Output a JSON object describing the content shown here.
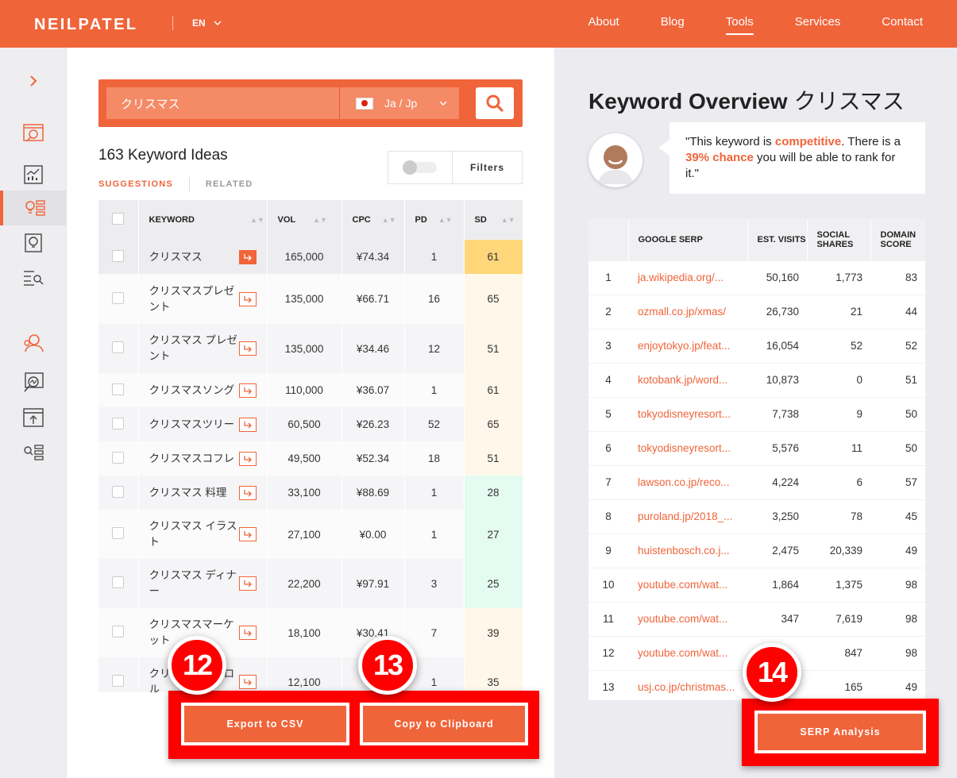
{
  "header": {
    "logo": "NEILPATEL",
    "language": "EN",
    "nav": [
      "About",
      "Blog",
      "Tools",
      "Services",
      "Contact"
    ],
    "active_nav": "Tools"
  },
  "search": {
    "value": "クリスマス",
    "language_label": "Ja / Jp"
  },
  "keywords": {
    "count_label": "163 Keyword Ideas",
    "tab_suggestions": "SUGGESTIONS",
    "tab_related": "RELATED",
    "filters_label": "Filters",
    "columns": [
      "KEYWORD",
      "VOL",
      "CPC",
      "PD",
      "SD"
    ],
    "rows": [
      {
        "keyword": "クリスマス",
        "vol": "165,000",
        "cpc": "¥74.34",
        "pd": "1",
        "sd": "61"
      },
      {
        "keyword": "クリスマスプレゼント",
        "vol": "135,000",
        "cpc": "¥66.71",
        "pd": "16",
        "sd": "65"
      },
      {
        "keyword": "クリスマス プレゼント",
        "vol": "135,000",
        "cpc": "¥34.46",
        "pd": "12",
        "sd": "51"
      },
      {
        "keyword": "クリスマスソング",
        "vol": "110,000",
        "cpc": "¥36.07",
        "pd": "1",
        "sd": "61"
      },
      {
        "keyword": "クリスマスツリー",
        "vol": "60,500",
        "cpc": "¥26.23",
        "pd": "52",
        "sd": "65"
      },
      {
        "keyword": "クリスマスコフレ",
        "vol": "49,500",
        "cpc": "¥52.34",
        "pd": "18",
        "sd": "51"
      },
      {
        "keyword": "クリスマス 料理",
        "vol": "33,100",
        "cpc": "¥88.69",
        "pd": "1",
        "sd": "28"
      },
      {
        "keyword": "クリスマス イラスト",
        "vol": "27,100",
        "cpc": "¥0.00",
        "pd": "1",
        "sd": "27"
      },
      {
        "keyword": "クリスマス ディナー",
        "vol": "22,200",
        "cpc": "¥97.91",
        "pd": "3",
        "sd": "25"
      },
      {
        "keyword": "クリスマスマーケット",
        "vol": "18,100",
        "cpc": "¥30.41",
        "pd": "7",
        "sd": "39"
      },
      {
        "keyword": "クリスマスキャロル",
        "vol": "12,100",
        "cpc": "",
        "pd": "1",
        "sd": "35"
      }
    ]
  },
  "overview": {
    "title": "Keyword Overview",
    "keyword": "クリスマス",
    "quote_open": "\"This keyword is ",
    "quote_strong1": "competitive",
    "quote_mid": ". There is a ",
    "quote_strong2": "39% chance",
    "quote_end": " you will be able to rank for it.\""
  },
  "serp": {
    "columns": [
      "GOOGLE SERP",
      "EST. VISITS",
      "SOCIAL SHARES",
      "DOMAIN SCORE"
    ],
    "rows": [
      {
        "rank": "1",
        "url": "ja.wikipedia.org/...",
        "visits": "50,160",
        "shares": "1,773",
        "score": "83"
      },
      {
        "rank": "2",
        "url": "ozmall.co.jp/xmas/",
        "visits": "26,730",
        "shares": "21",
        "score": "44"
      },
      {
        "rank": "3",
        "url": "enjoytokyo.jp/feat...",
        "visits": "16,054",
        "shares": "52",
        "score": "52"
      },
      {
        "rank": "4",
        "url": "kotobank.jp/word...",
        "visits": "10,873",
        "shares": "0",
        "score": "51"
      },
      {
        "rank": "5",
        "url": "tokyodisneyresort...",
        "visits": "7,738",
        "shares": "9",
        "score": "50"
      },
      {
        "rank": "6",
        "url": "tokyodisneyresort...",
        "visits": "5,576",
        "shares": "11",
        "score": "50"
      },
      {
        "rank": "7",
        "url": "lawson.co.jp/reco...",
        "visits": "4,224",
        "shares": "6",
        "score": "57"
      },
      {
        "rank": "8",
        "url": "puroland.jp/2018_...",
        "visits": "3,250",
        "shares": "78",
        "score": "45"
      },
      {
        "rank": "9",
        "url": "huistenbosch.co.j...",
        "visits": "2,475",
        "shares": "20,339",
        "score": "49"
      },
      {
        "rank": "10",
        "url": "youtube.com/wat...",
        "visits": "1,864",
        "shares": "1,375",
        "score": "98"
      },
      {
        "rank": "11",
        "url": "youtube.com/wat...",
        "visits": "347",
        "shares": "7,619",
        "score": "98"
      },
      {
        "rank": "12",
        "url": "youtube.com/wat...",
        "visits": "",
        "shares": "847",
        "score": "98"
      },
      {
        "rank": "13",
        "url": "usj.co.jp/christmas...",
        "visits": "",
        "shares": "165",
        "score": "49"
      }
    ]
  },
  "actions": {
    "export_csv": "Export to CSV",
    "copy_clipboard": "Copy to Clipboard",
    "serp_analysis": "SERP Analysis"
  },
  "annotations": {
    "badge_12": "12",
    "badge_13": "13",
    "badge_14": "14"
  },
  "colors": {
    "accent": "#f0643a",
    "highlight": "#ff0000"
  }
}
